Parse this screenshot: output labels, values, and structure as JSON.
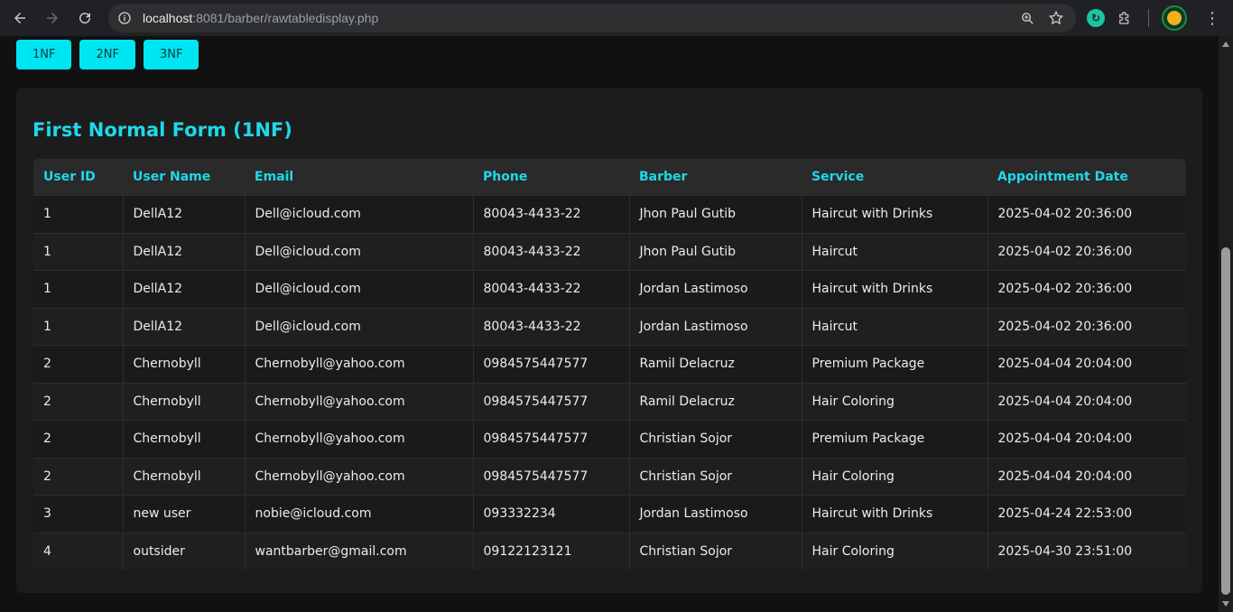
{
  "browser": {
    "url_host": "localhost",
    "url_rest": ":8081/barber/rawtabledisplay.php"
  },
  "nav_buttons": [
    {
      "label": "1NF"
    },
    {
      "label": "2NF"
    },
    {
      "label": "3NF"
    }
  ],
  "section": {
    "title": "First Normal Form (1NF)"
  },
  "table": {
    "headers": [
      "User ID",
      "User Name",
      "Email",
      "Phone",
      "Barber",
      "Service",
      "Appointment Date"
    ],
    "rows": [
      [
        "1",
        "DellA12",
        "Dell@icloud.com",
        "80043-4433-22",
        "Jhon Paul Gutib",
        "Haircut with Drinks",
        "2025-04-02 20:36:00"
      ],
      [
        "1",
        "DellA12",
        "Dell@icloud.com",
        "80043-4433-22",
        "Jhon Paul Gutib",
        "Haircut",
        "2025-04-02 20:36:00"
      ],
      [
        "1",
        "DellA12",
        "Dell@icloud.com",
        "80043-4433-22",
        "Jordan Lastimoso",
        "Haircut with Drinks",
        "2025-04-02 20:36:00"
      ],
      [
        "1",
        "DellA12",
        "Dell@icloud.com",
        "80043-4433-22",
        "Jordan Lastimoso",
        "Haircut",
        "2025-04-02 20:36:00"
      ],
      [
        "2",
        "Chernobyll",
        "Chernobyll@yahoo.com",
        "0984575447577",
        "Ramil Delacruz",
        "Premium Package",
        "2025-04-04 20:04:00"
      ],
      [
        "2",
        "Chernobyll",
        "Chernobyll@yahoo.com",
        "0984575447577",
        "Ramil Delacruz",
        "Hair Coloring",
        "2025-04-04 20:04:00"
      ],
      [
        "2",
        "Chernobyll",
        "Chernobyll@yahoo.com",
        "0984575447577",
        "Christian Sojor",
        "Premium Package",
        "2025-04-04 20:04:00"
      ],
      [
        "2",
        "Chernobyll",
        "Chernobyll@yahoo.com",
        "0984575447577",
        "Christian Sojor",
        "Hair Coloring",
        "2025-04-04 20:04:00"
      ],
      [
        "3",
        "new user",
        "nobie@icloud.com",
        "093332234",
        "Jordan Lastimoso",
        "Haircut with Drinks",
        "2025-04-24 22:53:00"
      ],
      [
        "4",
        "outsider",
        "wantbarber@gmail.com",
        "09122123121",
        "Christian Sojor",
        "Hair Coloring",
        "2025-04-30 23:51:00"
      ]
    ]
  },
  "colors": {
    "accent": "#00e5f2",
    "background": "#111111",
    "card": "#1c1c1c"
  }
}
